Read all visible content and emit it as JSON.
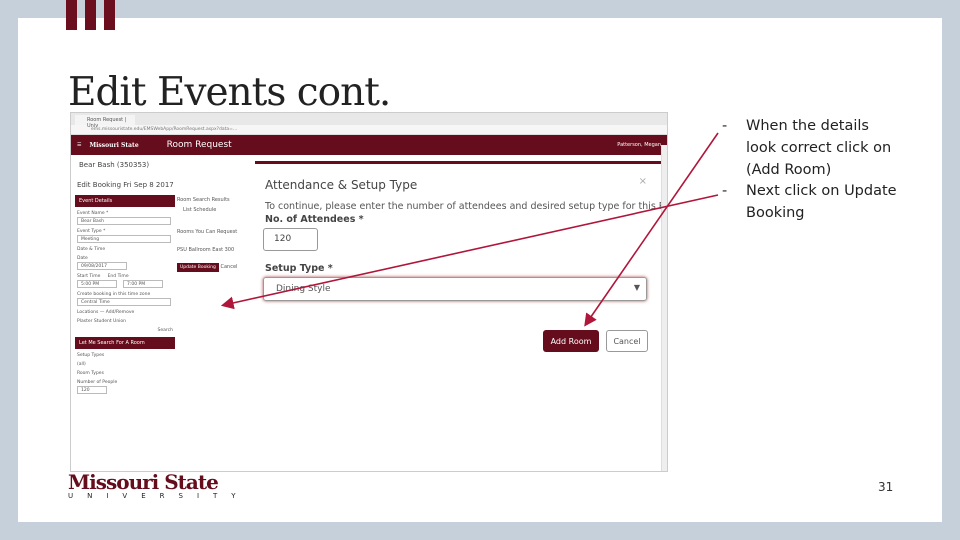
{
  "slide": {
    "title": "Edit Events cont.",
    "page_number": "31",
    "bullets": [
      "When the details look correct click on (Add Room)",
      "Next click on Update Booking"
    ],
    "logo_text": "Missouri State",
    "logo_sub": "UNIVERSITY"
  },
  "browser": {
    "tab": "Room Request | Univ",
    "url": "ems.missouristate.edu/EMSWebApp/RoomRequest.aspx?data=..."
  },
  "app": {
    "logo": "Missouri State",
    "title": "Room Request",
    "user": "Patterson, Megan"
  },
  "left": {
    "back": "Bear Bash (350353)",
    "edit_title": "Edit Booking Fri Sep 8 2017",
    "section": "Event Details",
    "event_name_label": "Event Name *",
    "event_name": "Bear Bash",
    "event_type_label": "Event Type *",
    "event_type": "Meeting",
    "date_time": "Date & Time",
    "date_label": "Date",
    "date": "09/08/2017",
    "start_label": "Start Time",
    "start": "5:00 PM",
    "end_label": "End Time",
    "end": "7:00 PM",
    "timezone_label": "Create booking in this time zone",
    "timezone": "Central Time",
    "locations": "Locations",
    "add_remove": "Add/Remove",
    "location": "Plaster Student Union",
    "search": "Search",
    "let_me": "Let Me Search For A Room",
    "setup_types": "Setup Types",
    "room_types": "Room Types",
    "any": "(all)",
    "people_label": "Number of People",
    "people": "120"
  },
  "middle": {
    "tabs": "Room Search Results",
    "list": "List",
    "schedule": "Schedule",
    "rooms": "Rooms You Can Request",
    "room": "PSU Ballroom East",
    "cap": "300",
    "update": "Update Booking",
    "cancel": "Cancel"
  },
  "modal": {
    "title": "Attendance & Setup Type",
    "close": "×",
    "description": "To continue, please enter the number of attendees and desired setup type for this Room.",
    "attendees_label": "No. of Attendees *",
    "attendees": "120",
    "setup_label": "Setup Type *",
    "setup": "Dining Style",
    "add_room": "Add Room",
    "cancel": "Cancel"
  },
  "colors": {
    "brand": "#650d1c",
    "arrow": "#b0163a",
    "frame": "#c6d0da"
  }
}
